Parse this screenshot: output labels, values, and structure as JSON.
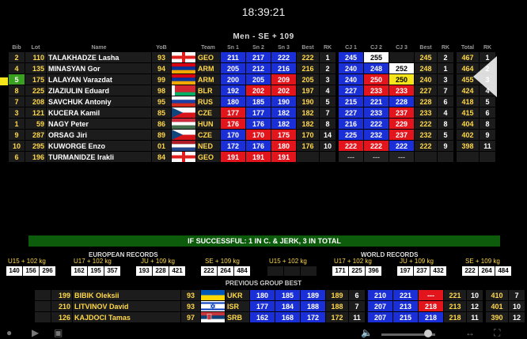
{
  "clock": "18:39:21",
  "group_title": "Men   - SE + 109",
  "headers": [
    "Bib",
    "Lot",
    "Name",
    "YoB",
    "Team",
    "Sn 1",
    "Sn 2",
    "Sn 3",
    "Best",
    "RK",
    "CJ 1",
    "CJ 2",
    "CJ 3",
    "Best",
    "RK",
    "Total",
    "RK"
  ],
  "athletes": [
    {
      "bib": "2",
      "lot": "110",
      "name": "TALAKHADZE Lasha",
      "yob": "93",
      "flag": "geo",
      "team": "GEO",
      "sn": [
        [
          "211",
          "good"
        ],
        [
          "217",
          "good"
        ],
        [
          "222",
          "good"
        ]
      ],
      "sn_best": "222",
      "sn_rk": "1",
      "cj": [
        [
          "245",
          "good"
        ],
        [
          "255",
          "white"
        ],
        [
          "",
          "empty"
        ]
      ],
      "cj_best": "245",
      "cj_rk": "2",
      "total": "467",
      "total_rk": "1"
    },
    {
      "bib": "4",
      "lot": "135",
      "name": "MINASYAN Gor",
      "yob": "94",
      "flag": "arm",
      "team": "ARM",
      "sn": [
        [
          "205",
          "good"
        ],
        [
          "212",
          "good"
        ],
        [
          "216",
          "good"
        ]
      ],
      "sn_best": "216",
      "sn_rk": "2",
      "cj": [
        [
          "240",
          "good"
        ],
        [
          "248",
          "good"
        ],
        [
          "252",
          "white"
        ]
      ],
      "cj_best": "248",
      "cj_rk": "1",
      "total": "464",
      "total_rk": "2"
    },
    {
      "bib": "5",
      "lot": "175",
      "name": "LALAYAN Varazdat",
      "yob": "99",
      "flag": "arm",
      "team": "ARM",
      "current": true,
      "sn": [
        [
          "200",
          "good"
        ],
        [
          "205",
          "good"
        ],
        [
          "209",
          "bad"
        ]
      ],
      "sn_best": "205",
      "sn_rk": "3",
      "cj": [
        [
          "240",
          "good"
        ],
        [
          "250",
          "bad"
        ],
        [
          "250",
          "cur"
        ]
      ],
      "cj_best": "240",
      "cj_rk": "3",
      "total": "455",
      "total_rk": "3"
    },
    {
      "bib": "8",
      "lot": "225",
      "name": "ZIAZIULIN Eduard",
      "yob": "98",
      "flag": "blr",
      "team": "BLR",
      "sn": [
        [
          "192",
          "good"
        ],
        [
          "202",
          "bad"
        ],
        [
          "202",
          "bad"
        ]
      ],
      "sn_best": "197",
      "sn_rk": "4",
      "cj": [
        [
          "227",
          "good"
        ],
        [
          "233",
          "bad"
        ],
        [
          "233",
          "bad"
        ]
      ],
      "cj_best": "227",
      "cj_rk": "7",
      "total": "424",
      "total_rk": "4"
    },
    {
      "bib": "7",
      "lot": "208",
      "name": "SAVCHUK Antoniy",
      "yob": "95",
      "flag": "rus",
      "team": "RUS",
      "sn": [
        [
          "180",
          "good"
        ],
        [
          "185",
          "good"
        ],
        [
          "190",
          "good"
        ]
      ],
      "sn_best": "190",
      "sn_rk": "5",
      "cj": [
        [
          "215",
          "good"
        ],
        [
          "221",
          "good"
        ],
        [
          "228",
          "good"
        ]
      ],
      "cj_best": "228",
      "cj_rk": "6",
      "total": "418",
      "total_rk": "5"
    },
    {
      "bib": "3",
      "lot": "121",
      "name": "KUCERA Kamil",
      "yob": "85",
      "flag": "cze",
      "team": "CZE",
      "sn": [
        [
          "177",
          "bad"
        ],
        [
          "177",
          "good"
        ],
        [
          "182",
          "good"
        ]
      ],
      "sn_best": "182",
      "sn_rk": "7",
      "cj": [
        [
          "227",
          "good"
        ],
        [
          "233",
          "good"
        ],
        [
          "237",
          "bad"
        ]
      ],
      "cj_best": "233",
      "cj_rk": "4",
      "total": "415",
      "total_rk": "6"
    },
    {
      "bib": "1",
      "lot": "59",
      "name": "NAGY Peter",
      "yob": "86",
      "flag": "hun",
      "team": "HUN",
      "sn": [
        [
          "176",
          "bad"
        ],
        [
          "176",
          "good"
        ],
        [
          "182",
          "good"
        ]
      ],
      "sn_best": "182",
      "sn_rk": "8",
      "cj": [
        [
          "216",
          "good"
        ],
        [
          "222",
          "good"
        ],
        [
          "229",
          "bad"
        ]
      ],
      "cj_best": "222",
      "cj_rk": "8",
      "total": "404",
      "total_rk": "8"
    },
    {
      "bib": "9",
      "lot": "287",
      "name": "ORSAG Jiri",
      "yob": "89",
      "flag": "cze",
      "team": "CZE",
      "sn": [
        [
          "170",
          "good"
        ],
        [
          "170",
          "bad"
        ],
        [
          "175",
          "bad"
        ]
      ],
      "sn_best": "170",
      "sn_rk": "14",
      "cj": [
        [
          "225",
          "good"
        ],
        [
          "232",
          "good"
        ],
        [
          "237",
          "bad"
        ]
      ],
      "cj_best": "232",
      "cj_rk": "5",
      "total": "402",
      "total_rk": "9"
    },
    {
      "bib": "10",
      "lot": "295",
      "name": "KUWORGE Enzo",
      "yob": "01",
      "flag": "ned",
      "team": "NED",
      "sn": [
        [
          "172",
          "good"
        ],
        [
          "176",
          "good"
        ],
        [
          "180",
          "bad"
        ]
      ],
      "sn_best": "176",
      "sn_rk": "10",
      "cj": [
        [
          "222",
          "bad"
        ],
        [
          "222",
          "bad"
        ],
        [
          "222",
          "good"
        ]
      ],
      "cj_best": "222",
      "cj_rk": "9",
      "total": "398",
      "total_rk": "11"
    },
    {
      "bib": "6",
      "lot": "196",
      "name": "TURMANIDZE Irakli",
      "yob": "84",
      "flag": "geo",
      "team": "GEO",
      "sn": [
        [
          "191",
          "bad"
        ],
        [
          "191",
          "bad"
        ],
        [
          "191",
          "bad"
        ]
      ],
      "sn_best": "",
      "sn_rk": "",
      "cj": [
        [
          "---",
          "dash"
        ],
        [
          "---",
          "dash"
        ],
        [
          "---",
          "dash"
        ]
      ],
      "cj_best": "",
      "cj_rk": "",
      "total": "",
      "total_rk": ""
    }
  ],
  "banner": "IF SUCCESSFUL: 1 IN C. & JERK, 3 IN TOTAL",
  "records": {
    "european_title": "EUROPEAN RECORDS",
    "world_title": "WORLD RECORDS",
    "labels": [
      "U15 + 102 kg",
      "U17 + 102 kg",
      "JU + 109 kg",
      "SE + 109 kg",
      "U15 + 102 kg",
      "U17 + 102 kg",
      "JU + 109 kg",
      "SE + 109 kg"
    ],
    "european": [
      [
        "140",
        "156",
        "296"
      ],
      [
        "162",
        "195",
        "357"
      ],
      [
        "193",
        "228",
        "421"
      ],
      [
        "222",
        "264",
        "484"
      ]
    ],
    "world": [
      [
        "",
        "",
        ""
      ],
      [
        "171",
        "225",
        "396"
      ],
      [
        "197",
        "237",
        "432"
      ],
      [
        "222",
        "264",
        "484"
      ]
    ]
  },
  "prev_title": "PREVIOUS GROUP BEST",
  "previous": [
    {
      "lot": "199",
      "name": "BIBIK Oleksii",
      "yob": "93",
      "flag": "ukr",
      "team": "UKR",
      "sn": [
        [
          "180",
          "good"
        ],
        [
          "185",
          "good"
        ],
        [
          "189",
          "good"
        ]
      ],
      "sn_best": "189",
      "sn_rk": "6",
      "cj": [
        [
          "210",
          "good"
        ],
        [
          "221",
          "good"
        ],
        [
          "---",
          "bad"
        ]
      ],
      "cj_best": "221",
      "cj_rk": "10",
      "total": "410",
      "total_rk": "7"
    },
    {
      "lot": "210",
      "name": "LITVINOV David",
      "yob": "93",
      "flag": "isr",
      "team": "ISR",
      "sn": [
        [
          "177",
          "good"
        ],
        [
          "184",
          "good"
        ],
        [
          "188",
          "good"
        ]
      ],
      "sn_best": "188",
      "sn_rk": "7",
      "cj": [
        [
          "207",
          "good"
        ],
        [
          "213",
          "good"
        ],
        [
          "218",
          "bad"
        ]
      ],
      "cj_best": "213",
      "cj_rk": "12",
      "total": "401",
      "total_rk": "10"
    },
    {
      "lot": "126",
      "name": "KAJDOCI Tamas",
      "yob": "97",
      "flag": "srb",
      "team": "SRB",
      "sn": [
        [
          "162",
          "good"
        ],
        [
          "168",
          "good"
        ],
        [
          "172",
          "good"
        ]
      ],
      "sn_best": "172",
      "sn_rk": "11",
      "cj": [
        [
          "207",
          "good"
        ],
        [
          "215",
          "good"
        ],
        [
          "218",
          "good"
        ]
      ],
      "cj_best": "218",
      "cj_rk": "11",
      "total": "390",
      "total_rk": "12"
    }
  ]
}
